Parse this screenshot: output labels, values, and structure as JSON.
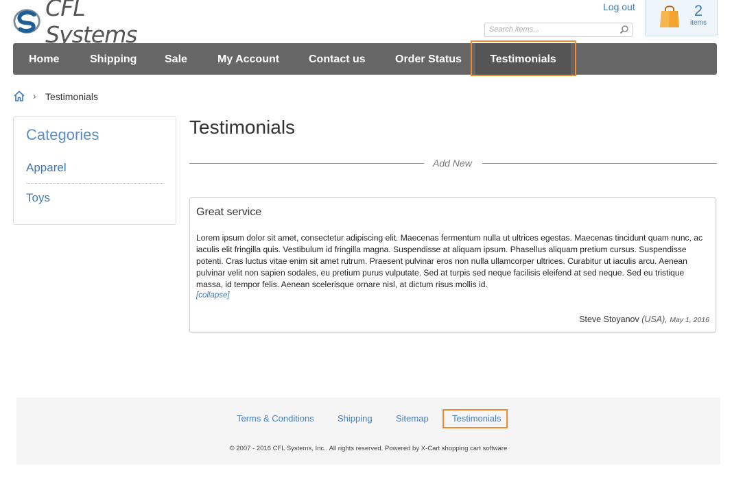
{
  "header": {
    "logo_text": "CFL Systems",
    "logout_label": "Log out",
    "search_placeholder": "Search items...",
    "cart_count": "2",
    "cart_items_label": "items"
  },
  "nav": {
    "items": [
      {
        "label": "Home"
      },
      {
        "label": "Shipping"
      },
      {
        "label": "Sale"
      },
      {
        "label": "My Account"
      },
      {
        "label": "Contact us"
      },
      {
        "label": "Order Status"
      },
      {
        "label": "Testimonials",
        "active": true
      }
    ]
  },
  "breadcrumb": {
    "separator": "›",
    "current": "Testimonials"
  },
  "sidebar": {
    "title": "Categories",
    "items": [
      {
        "label": "Apparel"
      },
      {
        "label": "Toys"
      }
    ]
  },
  "main": {
    "title": "Testimonials",
    "add_new_label": "Add New",
    "testimonial": {
      "title": "Great service",
      "body": "Lorem ipsum dolor sit amet, consectetur adipiscing elit. Maecenas fermentum nulla ut ultrices egestas. Maecenas tincidunt quam nunc, ac iaculis elit fringilla quis. Vestibulum id fringilla magna. Suspendisse at aliquam ipsum. Phasellus aliquam pretium cursus. Suspendisse potenti. Cras luctus vitae enim sit amet rutrum. Praesent pulvinar eros non nulla ullamcorper ultrices. Curabitur ut iaculis arcu. Aenean pulvinar velit non sapien sodales, eu pretium purus vulputate. Sed at turpis sed neque facilisis eleifend at sed neque. Sed eu tristique massa, id tempor felis. Aenean scelerisque ornare nisl, at dictum risus mollis id.",
      "collapse_label": "[collapse]",
      "author": "Steve Stoyanov",
      "country": "(USA),",
      "date": "May 1, 2016"
    }
  },
  "footer": {
    "links": [
      {
        "label": "Terms & Conditions"
      },
      {
        "label": "Shipping"
      },
      {
        "label": "Sitemap"
      },
      {
        "label": "Testimonials"
      }
    ],
    "copyright": "© 2007 - 2016 CFL Systems, Inc.. All rights reserved. Powered by X-Cart shopping cart software"
  },
  "colors": {
    "accent": "#3e79b5",
    "nav_bg": "#666666",
    "highlight": "#f08a2c"
  },
  "icons": [
    "logo-swirl-icon",
    "magnifier-icon",
    "shopping-bag-icon",
    "home-icon"
  ]
}
